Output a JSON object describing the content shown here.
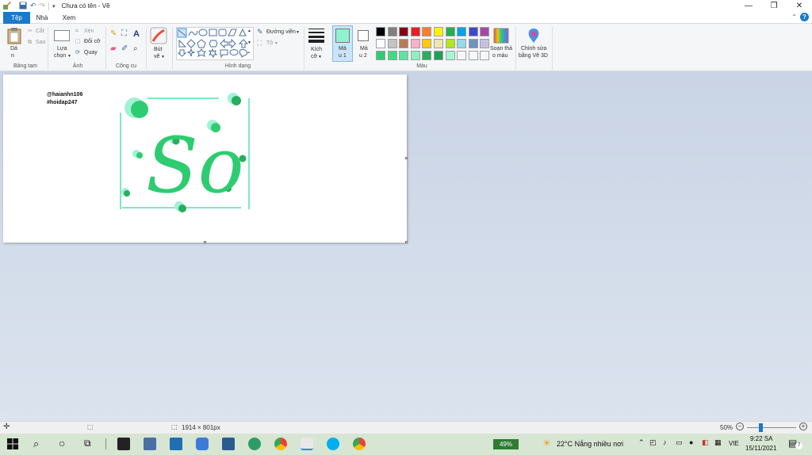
{
  "window": {
    "title": "Chưa có tên - Vẽ",
    "minimize": "—",
    "maximize": "❐",
    "close": "✕"
  },
  "tabs": {
    "file": "Tệp",
    "home": "Nhà",
    "view": "Xem"
  },
  "ribbon": {
    "clipboard": {
      "label": "Bảng tạm",
      "paste_top": "Dá",
      "paste_bottom": "n",
      "cut": "Cắt",
      "copy": "Sao"
    },
    "image": {
      "label": "Ảnh",
      "select_top": "Lựa",
      "select_bottom": "chọn",
      "crop": "Xén",
      "resize": "Đổi cỡ",
      "rotate": "Quay"
    },
    "tools": {
      "label": "Công cụ"
    },
    "brushes": {
      "top": "Bút",
      "bottom": "vẽ"
    },
    "shapes": {
      "label": "Hình dạng",
      "outline": "Đường viền",
      "fill": "Tô"
    },
    "size": {
      "top": "Kích",
      "bottom": "cỡ"
    },
    "color1": {
      "top": "Mà",
      "bottom": "u 1"
    },
    "color2": {
      "top": "Mà",
      "bottom": "u 2"
    },
    "colors": {
      "label": "Màu",
      "row1": [
        "#000000",
        "#7f7f7f",
        "#880015",
        "#ed1c24",
        "#ff7f27",
        "#fff200",
        "#22b14c",
        "#00a2e8",
        "#3f48cc",
        "#a349a4"
      ],
      "row2": [
        "#ffffff",
        "#c3c3c3",
        "#b97a57",
        "#ffaec9",
        "#ffc90e",
        "#efe4b0",
        "#b5e61d",
        "#99d9ea",
        "#7092be",
        "#c8bfe7"
      ],
      "row3": [
        "#2ecc71",
        "#3ddc84",
        "#5ae6a0",
        "#8ef0c0",
        "#27ae60",
        "#1e9e5a",
        "#a8f5d3",
        "#f7f7f7",
        "#f7f7f7",
        "#f7f7f7"
      ],
      "edit_top": "Soạn thả",
      "edit_bottom": "o màu",
      "paint3d_top": "Chỉnh sửa",
      "paint3d_bottom": "bằng Vẽ 3D",
      "active_color1": "#8ff2d1",
      "active_color2": "#ffffff"
    }
  },
  "canvas": {
    "watermark_line1": "@haianhn106",
    "watermark_line2": "#hoidap247",
    "drawing_text": "So"
  },
  "status": {
    "dimensions": "1914 × 801px",
    "zoom": "50%",
    "zoom_out": "−",
    "zoom_in": "+"
  },
  "taskbar": {
    "battery": "49%",
    "weather": "22°C  Nắng nhiều nơi",
    "language": "VIE",
    "time": "9:22 SA",
    "date": "15/11/2021",
    "notifications": "7"
  }
}
